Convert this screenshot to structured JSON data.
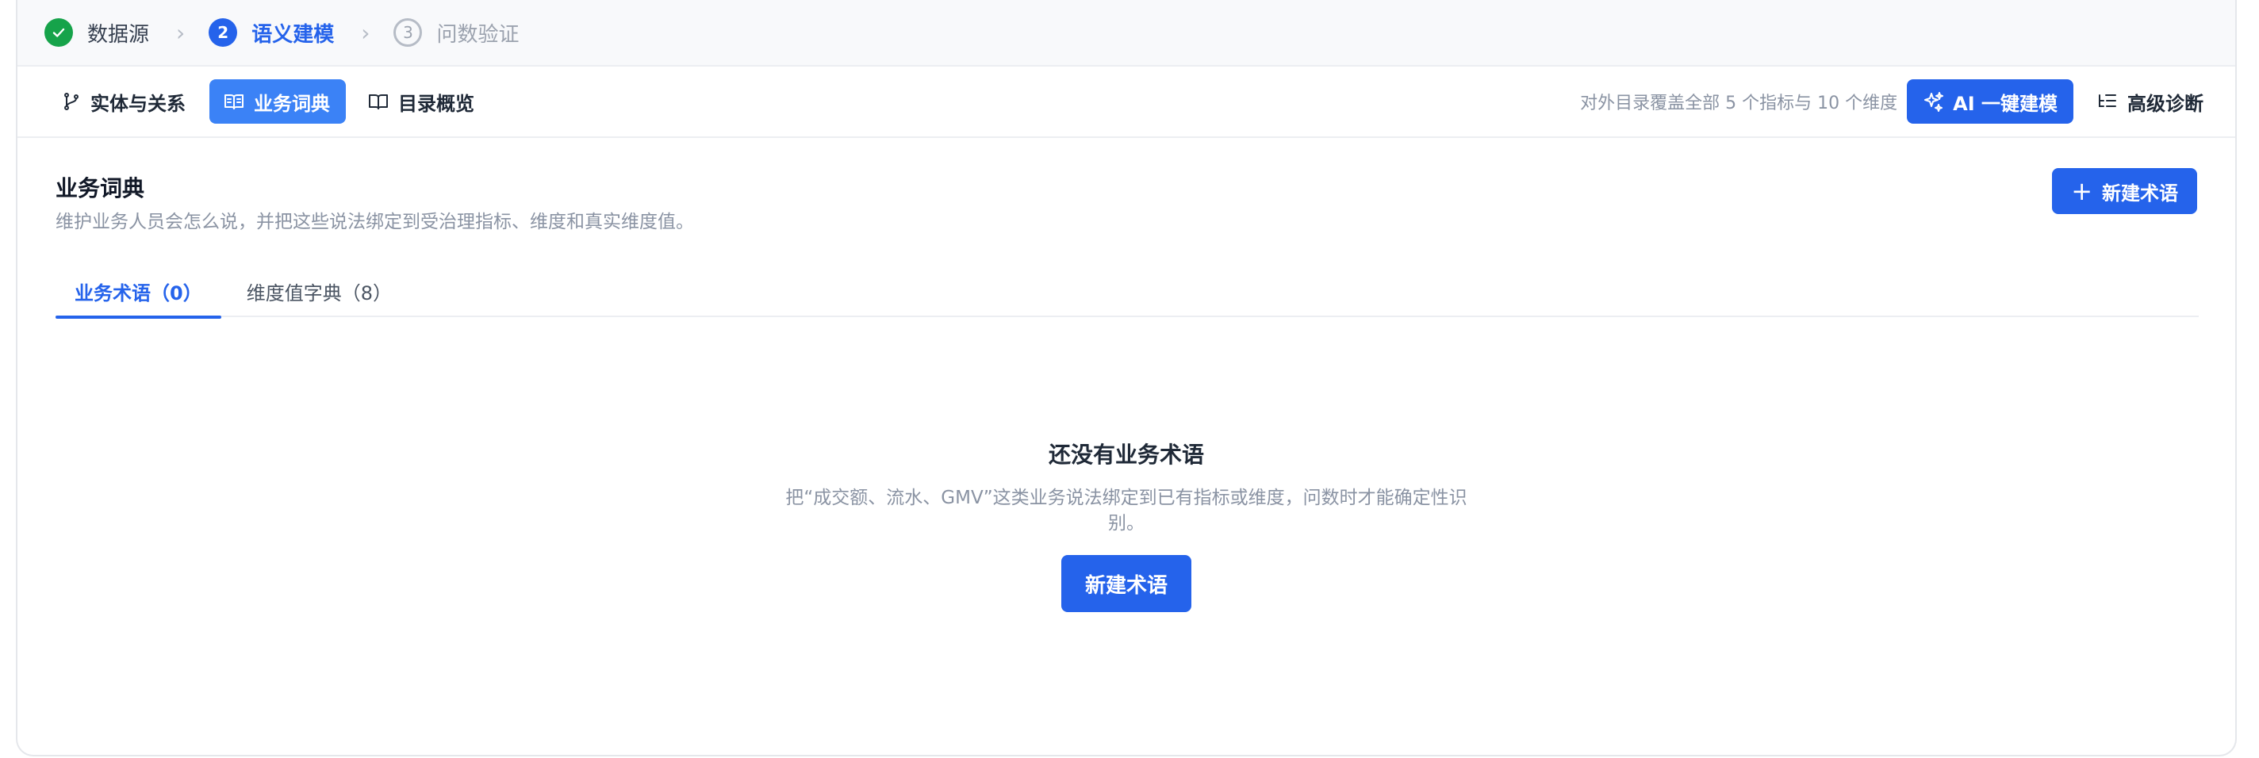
{
  "stepper": {
    "steps": [
      {
        "number": "",
        "label": "数据源",
        "state": "done"
      },
      {
        "number": "2",
        "label": "语义建模",
        "state": "active"
      },
      {
        "number": "3",
        "label": "问数验证",
        "state": "todo"
      }
    ],
    "separator": "›"
  },
  "toolbar": {
    "tabs": [
      {
        "label": "实体与关系",
        "icon": "git-branch-icon"
      },
      {
        "label": "业务词典",
        "icon": "book-open-icon",
        "active": true
      },
      {
        "label": "目录概览",
        "icon": "book-icon"
      }
    ],
    "coverage": "对外目录覆盖全部 5 个指标与 10 个维度",
    "ai_label": "AI 一键建模",
    "diagnose_label": "高级诊断"
  },
  "section": {
    "title": "业务词典",
    "subtitle": "维护业务人员会怎么说，并把这些说法绑定到受治理指标、维度和真实维度值。",
    "new_term_label": "新建术语",
    "plus": "+"
  },
  "tabs": [
    {
      "label": "业务术语（0）",
      "active": true
    },
    {
      "label": "维度值字典（8）",
      "active": false
    }
  ],
  "empty_state": {
    "title": "还没有业务术语",
    "description": "把“成交额、流水、GMV”这类业务说法绑定到已有指标或维度，问数时才能确定性识别。",
    "button_label": "新建术语"
  },
  "colors": {
    "primary": "#2563eb",
    "active_tab_bg": "#3b82f6",
    "success": "#16a34a",
    "muted_text": "#8a93a3"
  }
}
